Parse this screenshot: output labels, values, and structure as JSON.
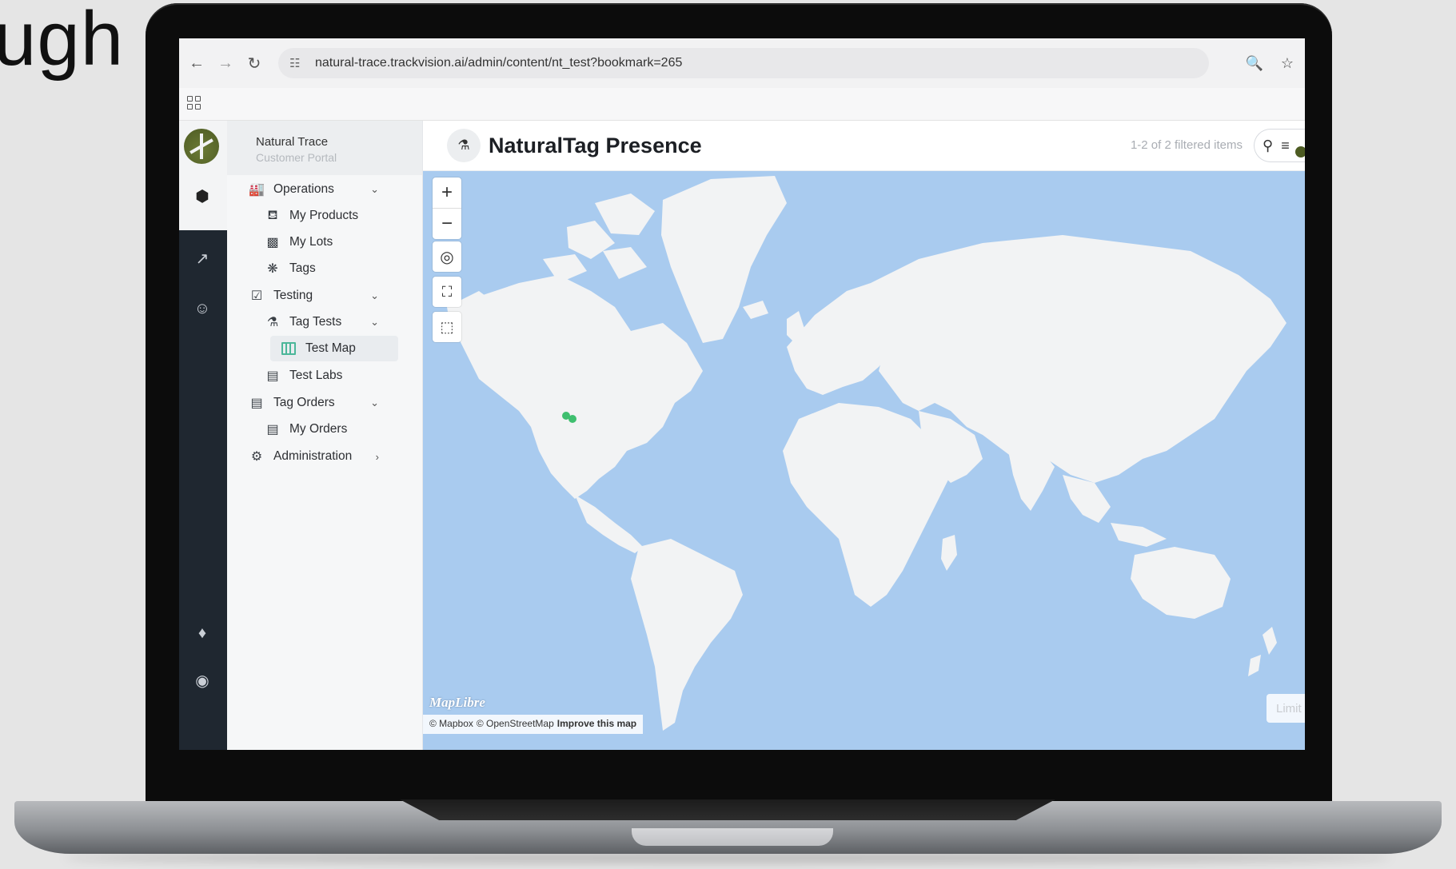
{
  "background_text": "ugh",
  "browser": {
    "back_icon": "arrow-left-icon",
    "forward_icon": "arrow-right-icon",
    "reload_icon": "reload-icon",
    "url": "natural-trace.trackvision.ai/admin/content/nt_test?bookmark=265",
    "zoom_icon": "zoom-icon",
    "star_icon": "star-icon"
  },
  "org": {
    "name": "Natural Trace",
    "subtitle": "Customer Portal"
  },
  "sidebar": {
    "items": [
      {
        "label": "Operations",
        "icon": "factory-icon",
        "expanded": true
      },
      {
        "label": "My Products",
        "icon": "bottle-icon"
      },
      {
        "label": "My Lots",
        "icon": "jar-icon"
      },
      {
        "label": "Tags",
        "icon": "molecule-icon"
      },
      {
        "label": "Testing",
        "icon": "calendar-check-icon",
        "expanded": true
      },
      {
        "label": "Tag Tests",
        "icon": "test-tube-search-icon",
        "expanded": true
      },
      {
        "label": "Test Map",
        "icon": "map-icon",
        "selected": true
      },
      {
        "label": "Test Labs",
        "icon": "lab-icon"
      },
      {
        "label": "Tag Orders",
        "icon": "order-icon",
        "expanded": true
      },
      {
        "label": "My Orders",
        "icon": "order-add-icon"
      },
      {
        "label": "Administration",
        "icon": "gear-cluster-icon",
        "expanded": false
      }
    ]
  },
  "header": {
    "title": "NaturalTag Presence",
    "icon": "test-tube-search-icon",
    "count": "1-2 of 2 filtered items"
  },
  "map": {
    "logo": "MapLibre",
    "attribution": [
      "© Mapbox",
      "© OpenStreetMap",
      "Improve this map"
    ],
    "limit_label": "Limit",
    "marker_color": "#3fbf6f",
    "ocean_color": "#a9cbef",
    "land_color": "#f2f3f4"
  },
  "accent": "#4d5b22"
}
